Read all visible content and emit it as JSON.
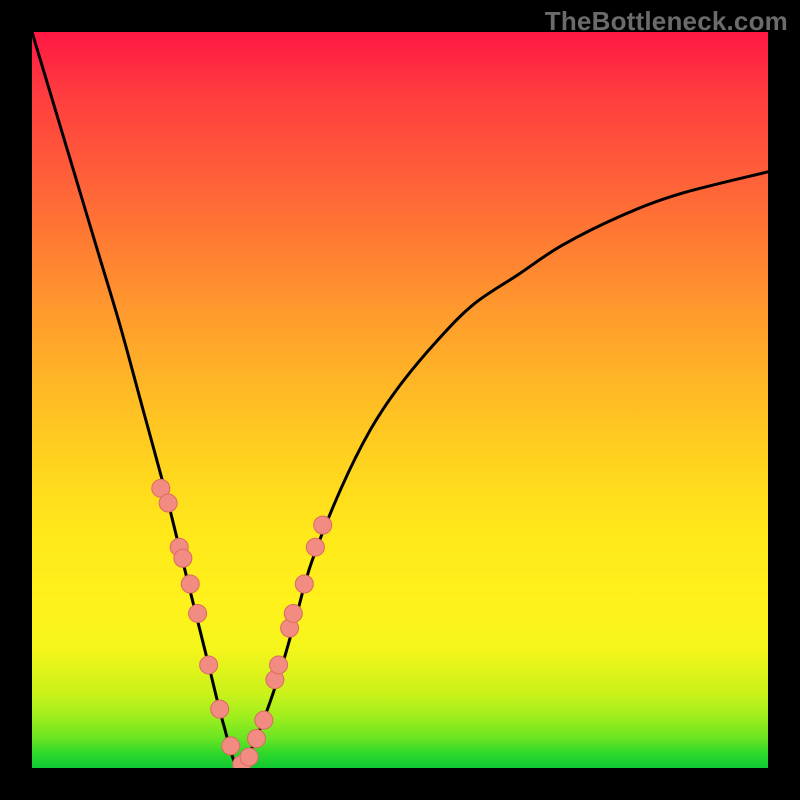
{
  "watermark": "TheBottleneck.com",
  "colors": {
    "curve": "#000000",
    "dot_fill": "#f28b82",
    "dot_stroke": "#d96a60"
  },
  "chart_data": {
    "type": "line",
    "title": "",
    "xlabel": "",
    "ylabel": "",
    "xlim": [
      0,
      1
    ],
    "ylim": [
      0,
      100
    ],
    "x_min_at": 0.28,
    "series": [
      {
        "name": "bottleneck-curve",
        "x": [
          0.0,
          0.03,
          0.06,
          0.09,
          0.12,
          0.15,
          0.18,
          0.2,
          0.22,
          0.24,
          0.26,
          0.28,
          0.3,
          0.32,
          0.34,
          0.36,
          0.38,
          0.42,
          0.46,
          0.5,
          0.55,
          0.6,
          0.66,
          0.72,
          0.8,
          0.88,
          1.0
        ],
        "y": [
          100,
          90,
          80,
          70,
          60,
          49,
          38,
          30,
          22,
          14,
          6,
          0,
          3,
          8,
          14,
          21,
          28,
          38,
          46,
          52,
          58,
          63,
          67,
          71,
          75,
          78,
          81
        ]
      }
    ],
    "highlight_points": {
      "name": "highlight-dots",
      "x": [
        0.175,
        0.185,
        0.2,
        0.205,
        0.215,
        0.225,
        0.24,
        0.255,
        0.27,
        0.285,
        0.295,
        0.305,
        0.315,
        0.33,
        0.335,
        0.35,
        0.355,
        0.37,
        0.385,
        0.395
      ],
      "y": [
        38,
        36,
        30,
        28.5,
        25,
        21,
        14,
        8,
        3,
        0.5,
        1.5,
        4,
        6.5,
        12,
        14,
        19,
        21,
        25,
        30,
        33
      ]
    }
  }
}
